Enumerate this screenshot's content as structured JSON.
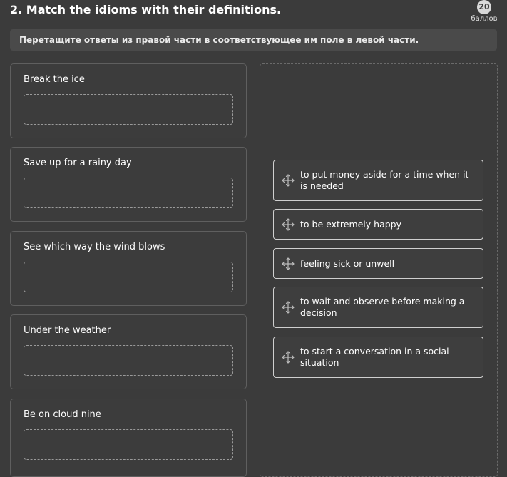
{
  "question": {
    "title": "2. Match the idioms with their definitions.",
    "points_value": "20",
    "points_label": "баллов",
    "instruction": "Перетащите ответы из правой части в соответствующее им поле в левой части."
  },
  "idioms": [
    {
      "label": "Break the ice"
    },
    {
      "label": "Save up for a rainy day"
    },
    {
      "label": "See which way the wind blows"
    },
    {
      "label": "Under the weather"
    },
    {
      "label": "Be on cloud nine"
    }
  ],
  "answers": [
    {
      "text": "to put money aside for a time when it is needed",
      "icon": "move-icon"
    },
    {
      "text": "to be extremely happy",
      "icon": "move-icon"
    },
    {
      "text": "feeling sick or unwell",
      "icon": "move-icon"
    },
    {
      "text": "to wait and observe before making a decision",
      "icon": "move-icon"
    },
    {
      "text": "to start a conversation in a social situation",
      "icon": "move-icon"
    }
  ],
  "colors": {
    "background": "#3b3b3b",
    "instruction_bg": "#4a4a4a",
    "answer_border": "#cfcfcf",
    "drop_border": "#9a9a9a"
  }
}
